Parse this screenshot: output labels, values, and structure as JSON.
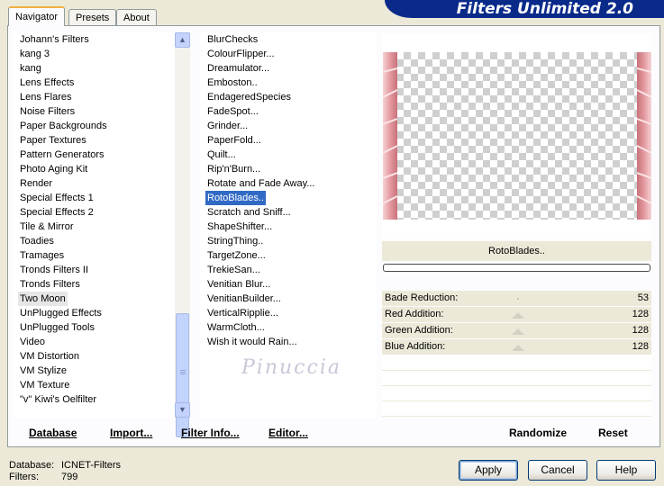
{
  "tabs": [
    {
      "label": "Navigator"
    },
    {
      "label": "Presets"
    },
    {
      "label": "About"
    }
  ],
  "banner_title": "Filters Unlimited 2.0",
  "categories": [
    "Johann's Filters",
    "kang 3",
    "kang",
    "Lens Effects",
    "Lens Flares",
    "Noise Filters",
    "Paper Backgrounds",
    "Paper Textures",
    "Pattern Generators",
    "Photo Aging Kit",
    "Render",
    "Special Effects 1",
    "Special Effects 2",
    "Tile & Mirror",
    "Toadies",
    "Tramages",
    "Tronds Filters II",
    "Tronds Filters",
    "Two Moon",
    "UnPlugged Effects",
    "UnPlugged Tools",
    "Video",
    "VM Distortion",
    "VM Stylize",
    "VM Texture",
    "\"v\" Kiwi's Oelfilter"
  ],
  "selected_category": "Two Moon",
  "filters": [
    "BlurChecks",
    "ColourFlipper...",
    "Dreamulator...",
    "Emboston..",
    "EndageredSpecies",
    "FadeSpot...",
    "Grinder...",
    "PaperFold...",
    "Quilt...",
    "Rip'n'Burn...",
    "Rotate and Fade Away...",
    "RotoBlades..",
    "Scratch and Sniff...",
    "ShapeShifter...",
    "StringThing..",
    "TargetZone...",
    "TrekieSan...",
    "Venitian Blur...",
    "VenitianBuilder...",
    "VerticalRipplie...",
    "WarmCloth...",
    "Wish it would Rain..."
  ],
  "selected_filter": "RotoBlades..",
  "watermark": "Pinuccia",
  "preview_filter_name": "RotoBlades..",
  "progress": 0,
  "params": [
    {
      "label": "Bade Reduction:",
      "value": "53"
    },
    {
      "label": "Red Addition:",
      "value": "128"
    },
    {
      "label": "Green Addition:",
      "value": "128"
    },
    {
      "label": "Blue Addition:",
      "value": "128"
    }
  ],
  "bottom_buttons": {
    "database": "Database",
    "import": "Import...",
    "filter_info": "Filter Info...",
    "editor": "Editor...",
    "randomize": "Randomize",
    "reset": "Reset"
  },
  "status": {
    "database_label": "Database:",
    "database_value": "ICNET-Filters",
    "filters_label": "Filters:",
    "filters_value": "799"
  },
  "dialog_buttons": {
    "apply": "Apply",
    "cancel": "Cancel",
    "help": "Help"
  },
  "colors": {
    "banner": "#0a2a8a",
    "selection": "#316ac5",
    "blade_pink": "#e8a4a8"
  }
}
